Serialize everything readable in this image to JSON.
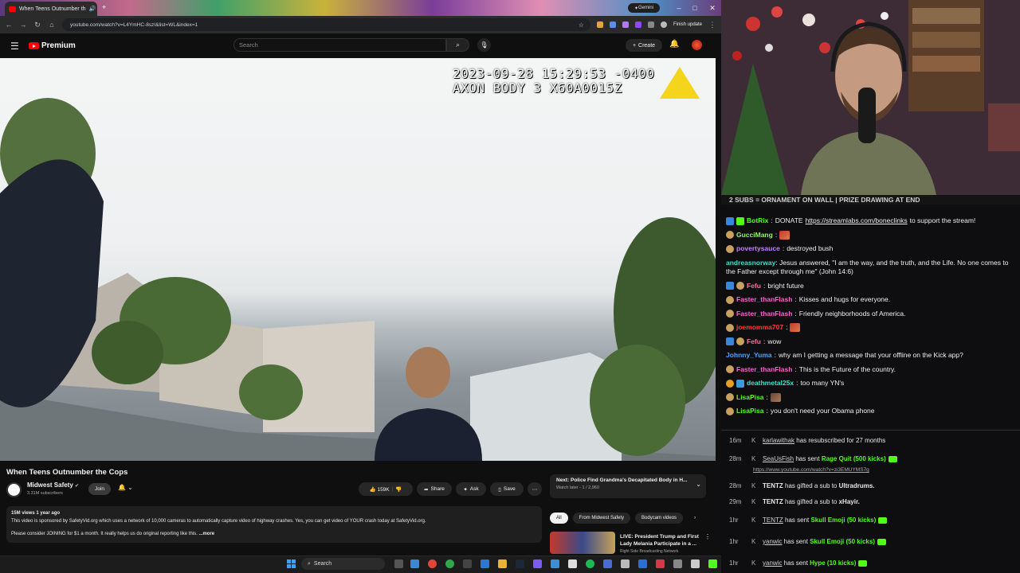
{
  "browser": {
    "tab_title": "When Teens Outnumber th",
    "gemini_label": "Gemini",
    "url": "youtube.com/watch?v=L4YmHC-8szI&list=WL&index=1",
    "finish_update": "Finish update"
  },
  "youtube": {
    "logo_text": "Premium",
    "search_placeholder": "Search",
    "create_label": "Create"
  },
  "video": {
    "overlay_line1": "2023-09-28 15:29:53 -0400",
    "overlay_line2": "AXON BODY 3 X60A0015Z",
    "title": "When Teens Outnumber the Cops",
    "channel": "Midwest Safety",
    "subscribers": "3.31M subscribers",
    "join_label": "Join",
    "likes": "159K",
    "share_label": "Share",
    "ask_label": "Ask",
    "save_label": "Save",
    "description_meta": "15M views  1 year ago",
    "description_line1": "This video is sponsored by SafetyVid.org which uses a network of 10,000 cameras to automatically capture video of highway crashes. Yes, you can get video of YOUR crash today at SafetyVid.org.",
    "description_line2": "Please consider JOINING for $1 a month. It really helps us do original reporting like this.",
    "more_label": "...more"
  },
  "sidebar": {
    "next_label": "Next: Police Find Grandma's Decapitated Body in H...",
    "next_sub": "Watch later - 1 / 2,960",
    "chips": [
      "All",
      "From Midwest Safety",
      "Bodycam videos"
    ],
    "rec_title": "LIVE: President Trump and First Lady Melania Participate in a ...",
    "rec_channel": "Right Side Broadcasting Network"
  },
  "stream": {
    "banner": "2 SUBS = ORNAMENT ON WALL | PRIZE DRAWING AT END"
  },
  "chat": [
    {
      "user": "BotRix",
      "color": "#53fc18",
      "sep": ":",
      "text": "DONATE ",
      "link": "https://streamlabs.com/boneclinks",
      "after": " to support the stream!"
    },
    {
      "user": "GucciMang",
      "color": "#9cf06a",
      "sep": ":",
      "text": ""
    },
    {
      "user": "povertysauce",
      "color": "#c77dff",
      "sep": ":",
      "text": "destroyed bush"
    },
    {
      "user": "andreasnorway",
      "color": "#41e0c8",
      "sep": ":",
      "text": "Jesus answered, \"I am the way, and the truth, and the Life. No one comes to the Father except through me\" (John 14:6)"
    },
    {
      "user": "Fefu",
      "color": "#ff6b9d",
      "sep": ":",
      "text": "bright future"
    },
    {
      "user": "Faster_thanFlash",
      "color": "#ff5fd2",
      "sep": ":",
      "text": "Kisses and hugs for everyone."
    },
    {
      "user": "Faster_thanFlash",
      "color": "#ff5fd2",
      "sep": ":",
      "text": "Friendly neighborhoods of America."
    },
    {
      "user": "joemomma707",
      "color": "#ff3b3b",
      "sep": ":",
      "text": ""
    },
    {
      "user": "Fefu",
      "color": "#ff6b9d",
      "sep": ":",
      "text": "wow"
    },
    {
      "user": "Johnny_Yuma",
      "color": "#4aa3ff",
      "sep": ":",
      "text": "why am I getting a message that your offline on the Kick app?"
    },
    {
      "user": "Faster_thanFlash",
      "color": "#ff5fd2",
      "sep": ":",
      "text": "This is the Future of the country."
    },
    {
      "user": "deathmetal25x",
      "color": "#41e0c8",
      "sep": ":",
      "text": "too many YN's"
    },
    {
      "user": "LisaPisa",
      "color": "#53fc18",
      "sep": ":",
      "text": ""
    },
    {
      "user": "LisaPisa",
      "color": "#53fc18",
      "sep": ":",
      "text": "you don't need your Obama phone"
    }
  ],
  "events": [
    {
      "time": "16m",
      "user": "karlawithak",
      "text": " has resubscribed for 27 months",
      "gift": ""
    },
    {
      "time": "28m",
      "user": "SeaUsFish",
      "text": " has sent ",
      "gift": "Rage Quit (500 kicks)",
      "sub": "https://www.youtube.com/watch?v=zi3EMUYMS7g"
    },
    {
      "time": "28m",
      "user": "TENTZ",
      "text": " has gifted a sub to ",
      "target": "Ultradrums."
    },
    {
      "time": "29m",
      "user": "TENTZ",
      "text": " has gifted a sub to ",
      "target": "xHayir."
    },
    {
      "time": "1hr",
      "user": "TENTZ",
      "text": " has sent ",
      "gift": "Skull Emoji (50 kicks)"
    },
    {
      "time": "1hr",
      "user": "yanwic",
      "text": " has sent ",
      "gift": "Skull Emoji (50 kicks)"
    },
    {
      "time": "1hr",
      "user": "yanwic",
      "text": " has sent ",
      "gift": "Hype (10 kicks)"
    }
  ],
  "taskbar": {
    "search_label": "Search"
  },
  "colors": {
    "accent_kick": "#53fc18",
    "youtube_red": "#ff0000"
  }
}
